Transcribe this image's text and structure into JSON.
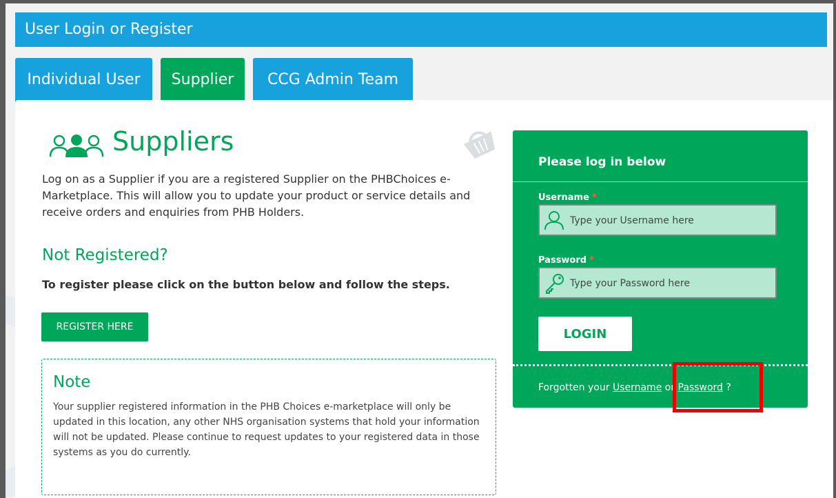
{
  "header": {
    "title": "User Login or Register"
  },
  "tabs": [
    {
      "label": "Individual User",
      "active": false
    },
    {
      "label": "Supplier",
      "active": true
    },
    {
      "label": "CCG Admin Team",
      "active": false
    }
  ],
  "supplier_section": {
    "title": "Suppliers",
    "intro": "Log on as a Supplier if you are a registered Supplier on the PHBChoices e-Marketplace. This will allow you to update your product or service details and receive orders and enquiries from PHB Holders.",
    "not_registered_heading": "Not Registered?",
    "register_instruction": "To register please click on the button below and follow the steps.",
    "register_button": "REGISTER HERE"
  },
  "note": {
    "title": "Note",
    "text": "Your supplier registered information in the PHB Choices e-marketplace will only be updated in this location, any other NHS organisation systems that hold your information will not be updated. Please continue to request updates to your registered data in those systems as you do currently."
  },
  "login": {
    "heading": "Please log in below",
    "username_label": "Username",
    "username_placeholder": "Type your Username here",
    "password_label": "Password",
    "password_placeholder": "Type your Password here",
    "required_marker": "*",
    "login_button": "LOGIN",
    "forgot_prefix": "Forgotten your",
    "forgot_username": "Username",
    "forgot_or": "or",
    "forgot_password": "Password",
    "forgot_suffix": "?"
  },
  "colors": {
    "header_blue": "#17a2dd",
    "brand_green": "#00a65a",
    "field_bg": "#b6e7d0",
    "highlight_red": "#ee0000"
  },
  "icons": [
    "users-group-icon",
    "basket-watermark-icon",
    "user-icon",
    "key-icon"
  ]
}
